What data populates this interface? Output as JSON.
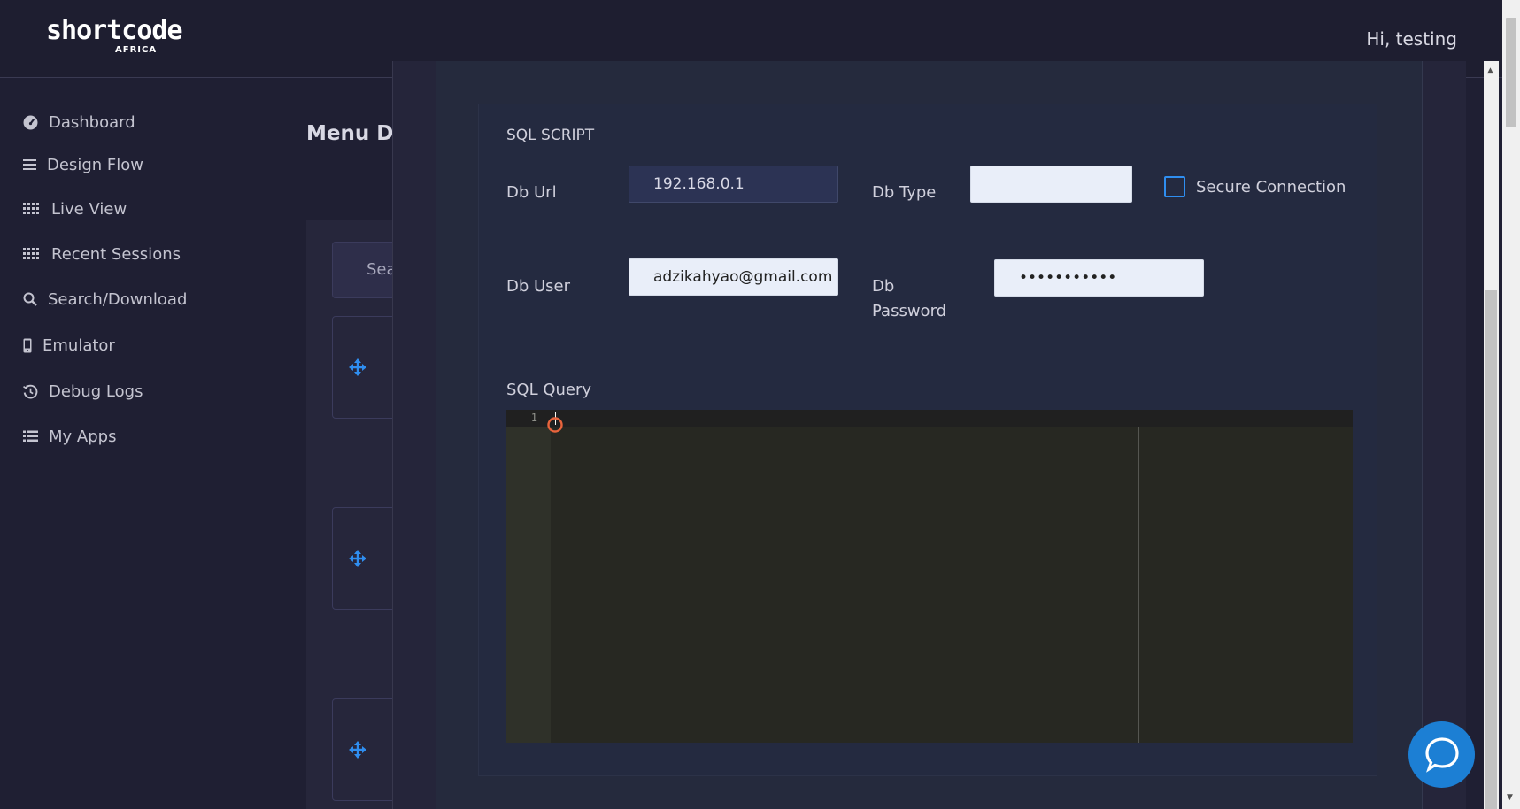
{
  "header": {
    "logo_text": "shortcode",
    "logo_sub": "AFRICA",
    "greeting": "Hi, testing"
  },
  "sidebar": {
    "items": [
      {
        "label": "Dashboard",
        "icon": "speedometer-icon"
      },
      {
        "label": "Design Flow",
        "icon": "menu-lines-icon"
      },
      {
        "label": "Live View",
        "icon": "grid-dots-icon"
      },
      {
        "label": "Recent Sessions",
        "icon": "grid-dots-icon"
      },
      {
        "label": "Search/Download",
        "icon": "search-icon"
      },
      {
        "label": "Emulator",
        "icon": "phone-icon"
      },
      {
        "label": "Debug Logs",
        "icon": "history-icon"
      },
      {
        "label": "My Apps",
        "icon": "list-icon"
      }
    ]
  },
  "background": {
    "page_title": "Menu De",
    "search_label": "Sea",
    "card_icon": "move-arrows-icon"
  },
  "form": {
    "section_title": "SQL SCRIPT",
    "db_url_label": "Db Url",
    "db_url_value": "192.168.0.1",
    "db_type_label": "Db Type",
    "db_type_value": "",
    "secure_connection_label": "Secure Connection",
    "secure_connection_checked": false,
    "db_user_label": "Db User",
    "db_user_value": "adzikahyao@gmail.com",
    "db_password_label_line1": "Db",
    "db_password_label_line2": "Password",
    "db_password_value": "•••••••••••",
    "sql_query_label": "SQL Query"
  },
  "editor": {
    "line_numbers": [
      "1"
    ],
    "content": "",
    "theme": "monokai"
  },
  "colors": {
    "accent": "#2f8ef0",
    "chat_button": "#1c7fd4",
    "background": "#1f1f33"
  }
}
